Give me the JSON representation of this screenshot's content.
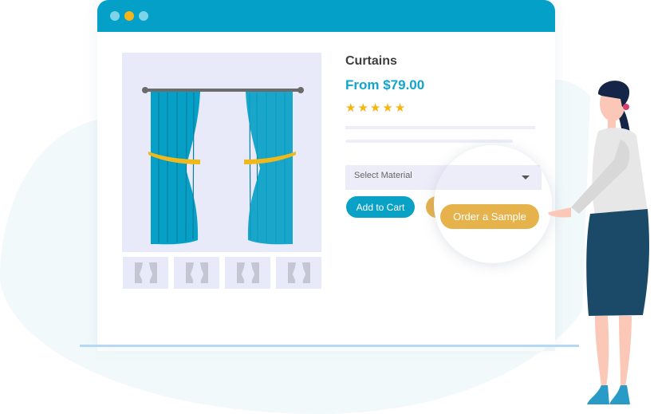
{
  "window": {
    "controls": [
      "close",
      "minimize",
      "maximize"
    ],
    "colors": {
      "titlebar": "#04a0c8",
      "dot_light": "#7dd3e8",
      "dot_accent": "#f5b518"
    }
  },
  "product": {
    "title": "Curtains",
    "price": "From $79.00",
    "rating": 5,
    "rating_max": 5,
    "stars": [
      "★",
      "★",
      "★",
      "★",
      "★"
    ],
    "thumbnail_count": 4
  },
  "material_select": {
    "placeholder": "Select Material"
  },
  "buttons": {
    "add_to_cart": "Add to Cart",
    "order_sample": "Order a Sample"
  },
  "colors": {
    "primary": "#09a1c6",
    "accent_gold": "#e6b24c",
    "price": "#12a4cc",
    "star": "#f7b50f"
  }
}
